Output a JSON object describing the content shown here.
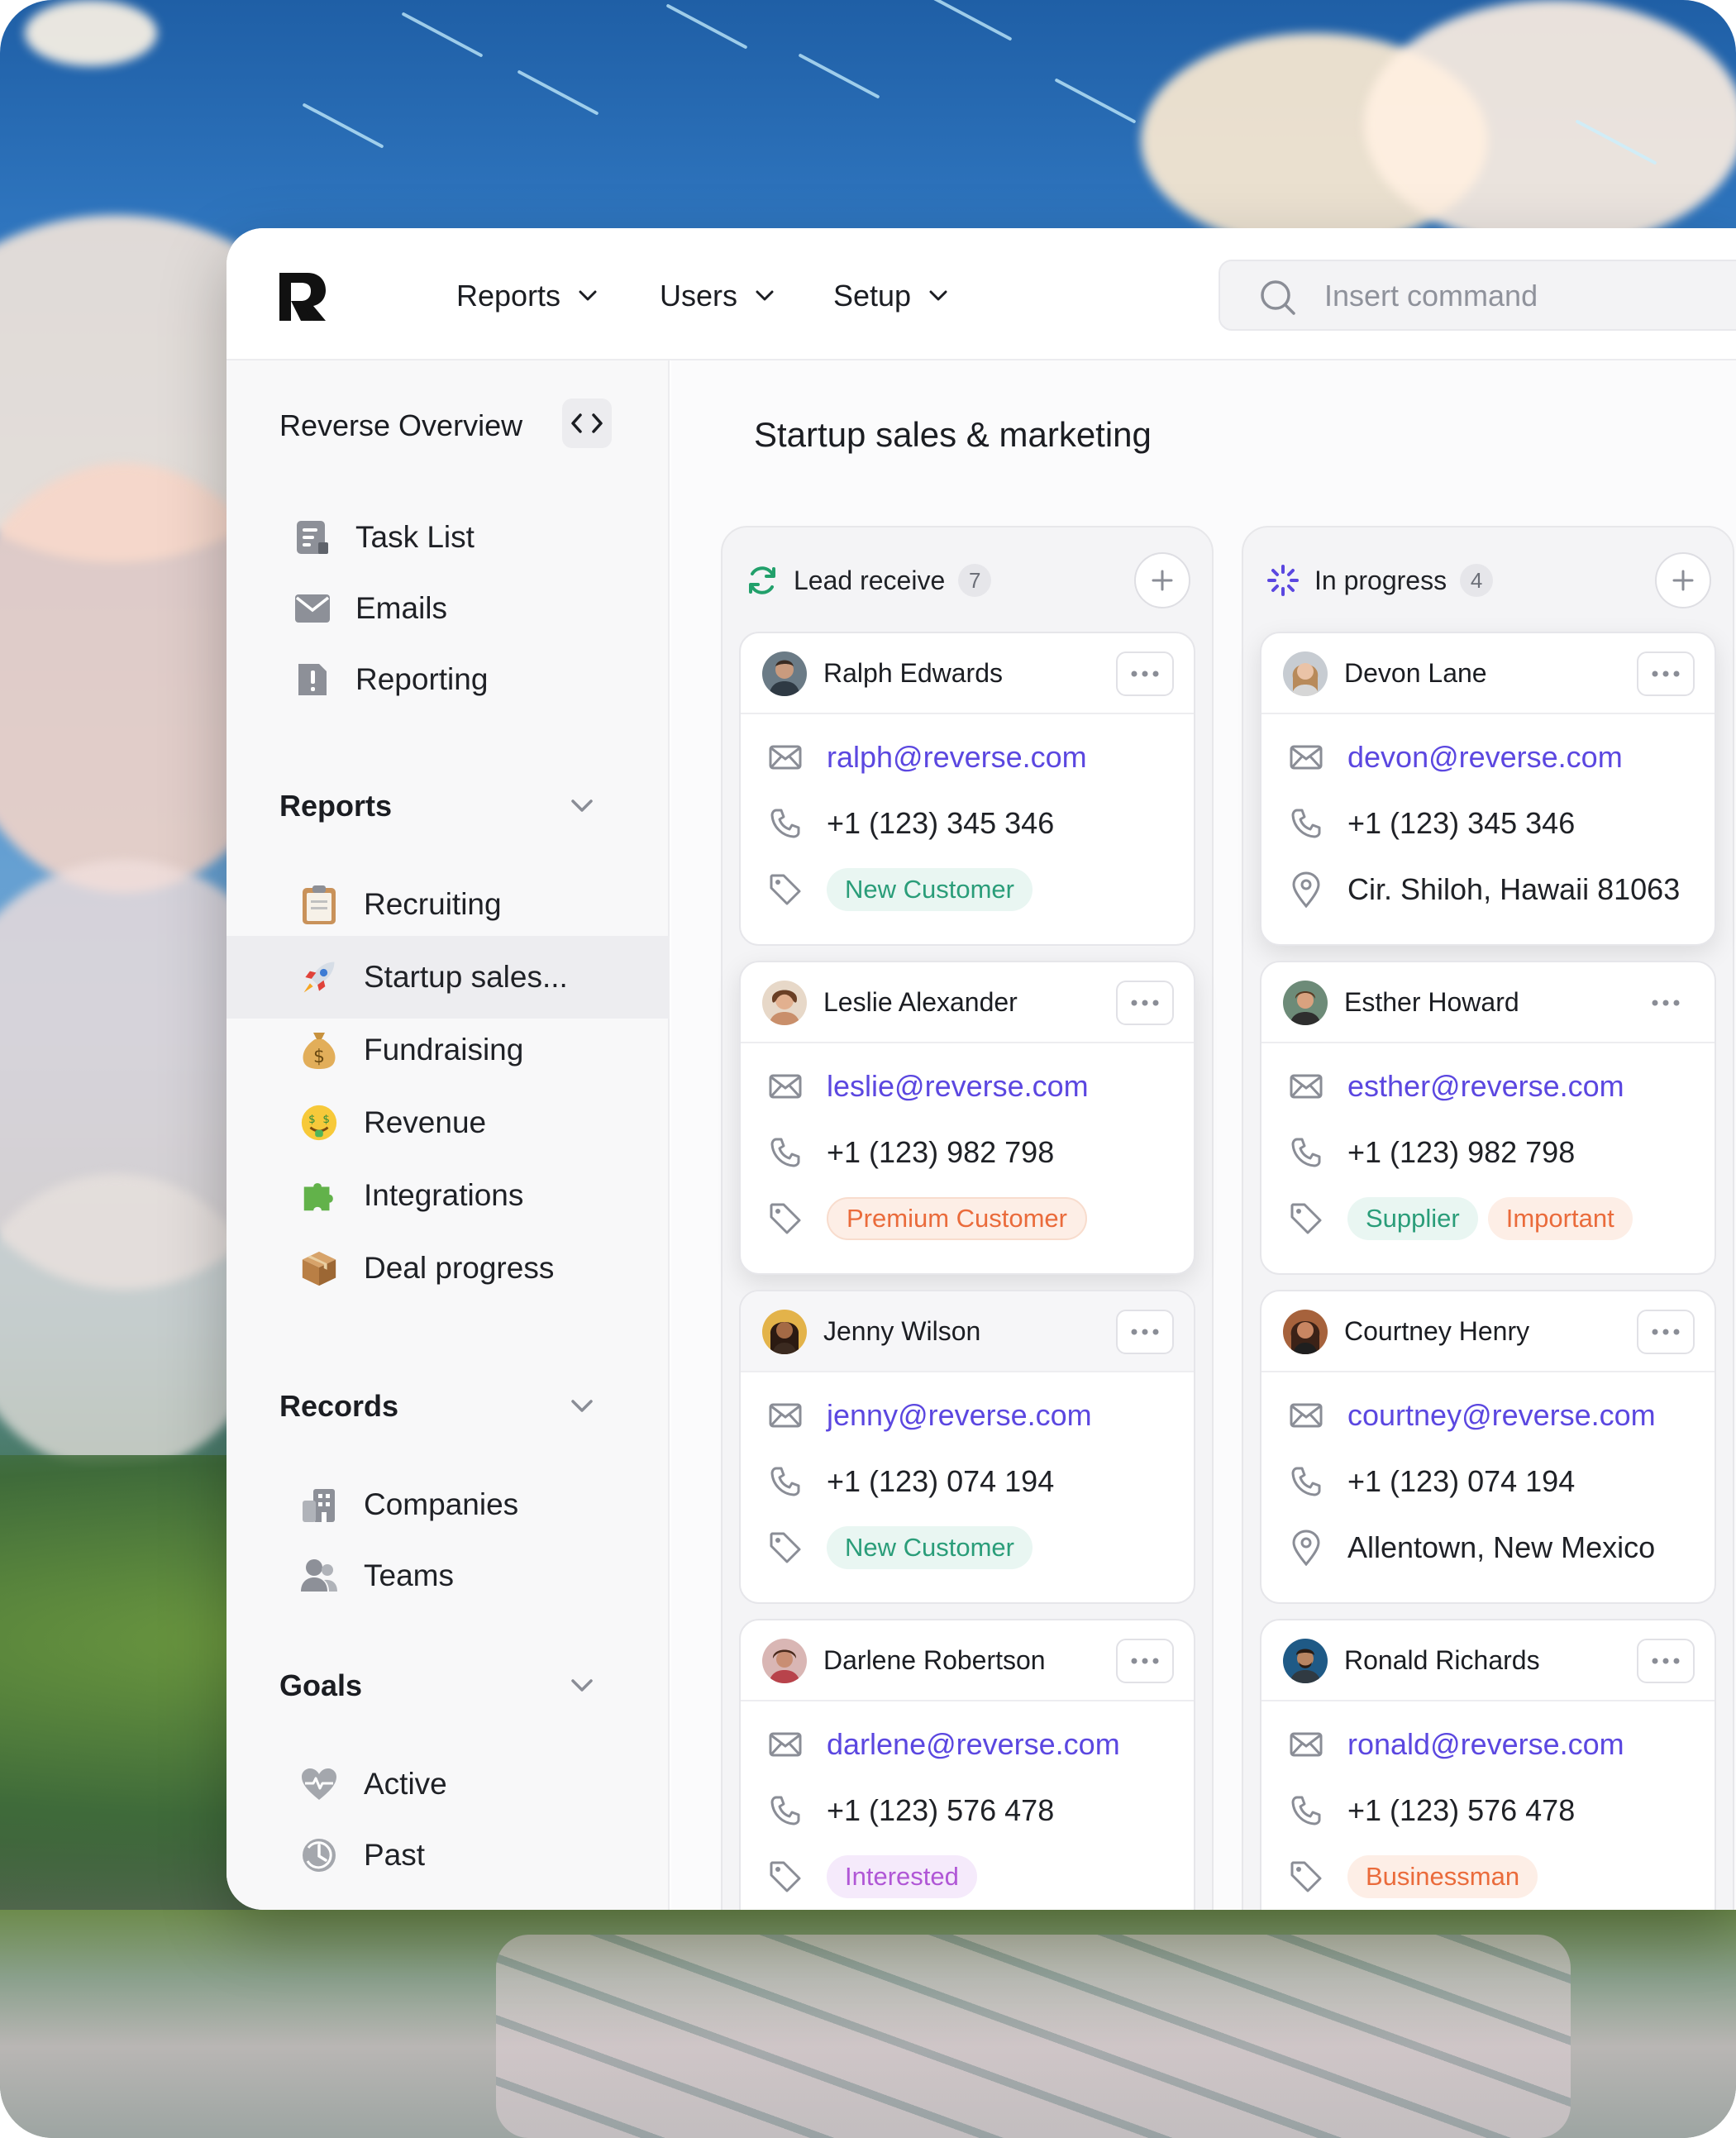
{
  "topbar": {
    "nav": [
      {
        "label": "Reports"
      },
      {
        "label": "Users"
      },
      {
        "label": "Setup"
      }
    ],
    "search": {
      "placeholder": "Insert command"
    }
  },
  "sidebar": {
    "overview_title": "Reverse Overview",
    "top_items": [
      {
        "label": "Task List",
        "icon": "task-list-icon"
      },
      {
        "label": "Emails",
        "icon": "mail-icon"
      },
      {
        "label": "Reporting",
        "icon": "report-icon"
      }
    ],
    "reports": {
      "title": "Reports",
      "items": [
        {
          "label": "Recruiting",
          "icon": "clipboard-emoji"
        },
        {
          "label": "Startup sales...",
          "icon": "rocket-emoji",
          "active": true
        },
        {
          "label": "Fundraising",
          "icon": "money-bag-emoji"
        },
        {
          "label": "Revenue",
          "icon": "money-face-emoji"
        },
        {
          "label": "Integrations",
          "icon": "puzzle-emoji"
        },
        {
          "label": "Deal progress",
          "icon": "package-emoji"
        }
      ]
    },
    "records": {
      "title": "Records",
      "items": [
        {
          "label": "Companies",
          "icon": "building-icon"
        },
        {
          "label": "Teams",
          "icon": "users-icon"
        }
      ]
    },
    "goals": {
      "title": "Goals",
      "items": [
        {
          "label": "Active",
          "icon": "heartbeat-icon"
        },
        {
          "label": "Past",
          "icon": "history-icon"
        }
      ]
    }
  },
  "main": {
    "title": "Startup sales & marketing",
    "columns": [
      {
        "title": "Lead receive",
        "count": "7",
        "cards": [
          {
            "name": "Ralph Edwards",
            "email": "ralph@reverse.com",
            "phone": "+1 (123) 345 346",
            "tags": [
              {
                "label": "New Customer",
                "color": "green"
              }
            ]
          },
          {
            "name": "Leslie Alexander",
            "email": "leslie@reverse.com",
            "phone": "+1 (123) 982 798",
            "tags": [
              {
                "label": "Premium Customer",
                "color": "orange"
              }
            ]
          },
          {
            "name": "Jenny Wilson",
            "email": "jenny@reverse.com",
            "phone": "+1 (123) 074 194",
            "tags": [
              {
                "label": "New Customer",
                "color": "green"
              }
            ]
          },
          {
            "name": "Darlene Robertson",
            "email": "darlene@reverse.com",
            "phone": "+1 (123) 576 478",
            "tags": [
              {
                "label": "Interested",
                "color": "purple"
              }
            ]
          }
        ]
      },
      {
        "title": "In progress",
        "count": "4",
        "cards": [
          {
            "name": "Devon Lane",
            "email": "devon@reverse.com",
            "phone": "+1 (123) 345 346",
            "location": "Cir. Shiloh, Hawaii 81063"
          },
          {
            "name": "Esther Howard",
            "email": "esther@reverse.com",
            "phone": "+1 (123) 982 798",
            "tags": [
              {
                "label": "Supplier",
                "color": "green"
              },
              {
                "label": "Important",
                "color": "orange"
              }
            ]
          },
          {
            "name": "Courtney Henry",
            "email": "courtney@reverse.com",
            "phone": "+1 (123) 074 194",
            "location": "Allentown, New Mexico"
          },
          {
            "name": "Ronald Richards",
            "email": "ronald@reverse.com",
            "phone": "+1 (123) 576 478",
            "tags": [
              {
                "label": "Businessman",
                "color": "orange"
              }
            ]
          }
        ]
      }
    ]
  },
  "colors": {
    "accent_email": "#5b47e0",
    "tag_green": "#2a9d79",
    "tag_orange": "#ea6b3b",
    "tag_purple": "#b057d6",
    "lead_icon": "#22a06b",
    "progress_icon": "#5b47e0"
  }
}
